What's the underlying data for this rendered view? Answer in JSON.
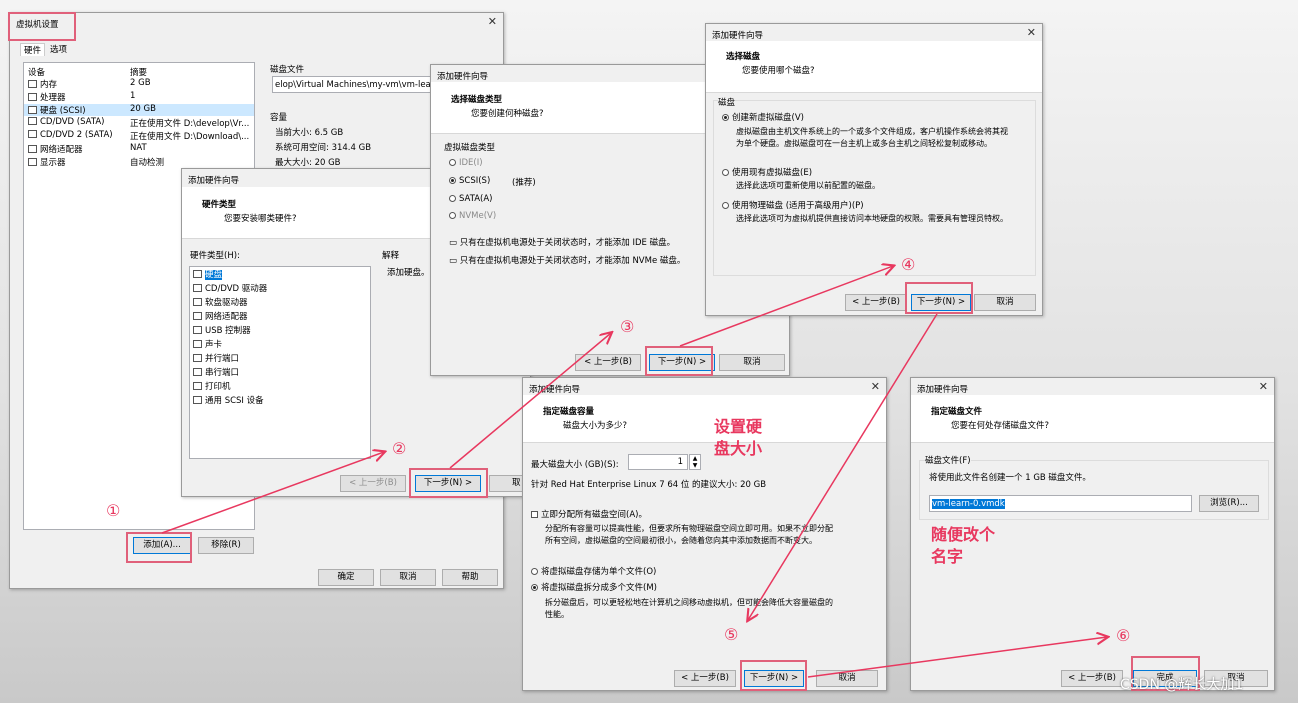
{
  "vmsettings": {
    "title": "虚拟机设置",
    "tab_hardware": "硬件",
    "tab_options": "选项",
    "col_device": "设备",
    "col_summary": "摘要",
    "devices": [
      {
        "icon": "memory-icon",
        "name": "内存",
        "summary": "2 GB"
      },
      {
        "icon": "cpu-icon",
        "name": "处理器",
        "summary": "1"
      },
      {
        "icon": "harddisk-icon",
        "name": "硬盘 (SCSI)",
        "summary": "20 GB"
      },
      {
        "icon": "cd-icon",
        "name": "CD/DVD (SATA)",
        "summary": "正在使用文件 D:\\develop\\Vr..."
      },
      {
        "icon": "cd-icon",
        "name": "CD/DVD 2 (SATA)",
        "summary": "正在使用文件 D:\\Download\\..."
      },
      {
        "icon": "network-icon",
        "name": "网络适配器",
        "summary": "NAT"
      },
      {
        "icon": "display-icon",
        "name": "显示器",
        "summary": "自动检测"
      }
    ],
    "diskfile_label": "磁盘文件",
    "diskfile_value": "elop\\Virtual Machines\\my-vm\\vm-learn\\vr",
    "capacity_label": "容量",
    "current_size": "当前大小: 6.5 GB",
    "free_space": "系统可用空间: 314.4 GB",
    "max_size": "最大大小: 20 GB",
    "add": "添加(A)...",
    "remove": "移除(R)",
    "ok": "确定",
    "cancel": "取消",
    "help": "帮助"
  },
  "wiz1": {
    "title": "添加硬件向导",
    "heading": "硬件类型",
    "sub": "您要安装哪类硬件?",
    "list_label": "硬件类型(H):",
    "explain_label": "解释",
    "explain_text": "添加硬盘。",
    "items": [
      {
        "icon": "harddisk-icon",
        "label": "硬盘"
      },
      {
        "icon": "cd-icon",
        "label": "CD/DVD 驱动器"
      },
      {
        "icon": "floppy-icon",
        "label": "软盘驱动器"
      },
      {
        "icon": "network-icon",
        "label": "网络适配器"
      },
      {
        "icon": "usb-icon",
        "label": "USB 控制器"
      },
      {
        "icon": "sound-icon",
        "label": "声卡"
      },
      {
        "icon": "parallel-port-icon",
        "label": "并行端口"
      },
      {
        "icon": "serial-port-icon",
        "label": "串行端口"
      },
      {
        "icon": "printer-icon",
        "label": "打印机"
      },
      {
        "icon": "scsi-icon",
        "label": "通用 SCSI 设备"
      }
    ],
    "back": "< 上一步(B)",
    "next": "下一步(N) >",
    "cancel_cut": "取"
  },
  "wiz2": {
    "title": "添加硬件向导",
    "heading": "选择磁盘类型",
    "sub": "您要创建何种磁盘?",
    "group": "虚拟磁盘类型",
    "ide": "IDE(I)",
    "scsi": "SCSI(S)",
    "recommended": "(推荐)",
    "sata": "SATA(A)",
    "nvme": "NVMe(V)",
    "note_ide": "只有在虚拟机电源处于关闭状态时，才能添加 IDE 磁盘。",
    "note_nvme": "只有在虚拟机电源处于关闭状态时，才能添加 NVMe 磁盘。",
    "back": "< 上一步(B)",
    "next": "下一步(N) >",
    "cancel": "取消"
  },
  "wiz3": {
    "title": "添加硬件向导",
    "heading": "选择磁盘",
    "sub": "您要使用哪个磁盘?",
    "group": "磁盘",
    "opt_new": "创建新虚拟磁盘(V)",
    "opt_new_desc1": "虚拟磁盘由主机文件系统上的一个或多个文件组成，客户机操作系统会将其视",
    "opt_new_desc2": "为单个硬盘。虚拟磁盘可在一台主机上或多台主机之间轻松复制或移动。",
    "opt_existing": "使用现有虚拟磁盘(E)",
    "opt_existing_desc": "选择此选项可重新使用以前配置的磁盘。",
    "opt_physical": "使用物理磁盘 (适用于高级用户)(P)",
    "opt_physical_desc": "选择此选项可为虚拟机提供直接访问本地硬盘的权限。需要具有管理员特权。",
    "back": "< 上一步(B)",
    "next": "下一步(N) >",
    "cancel": "取消"
  },
  "wiz4": {
    "title": "添加硬件向导",
    "heading": "指定磁盘容量",
    "sub": "磁盘大小为多少?",
    "size_label": "最大磁盘大小 (GB)(S):",
    "size_value": "1",
    "recommend": "针对 Red Hat Enterprise Linux 7 64 位 的建议大小: 20 GB",
    "allocate": "立即分配所有磁盘空间(A)。",
    "allocate_desc1": "分配所有容量可以提高性能，但要求所有物理磁盘空间立即可用。如果不立即分配",
    "allocate_desc2": "所有空间，虚拟磁盘的空间最初很小，会随着您向其中添加数据而不断变大。",
    "single": "将虚拟磁盘存储为单个文件(O)",
    "multi": "将虚拟磁盘拆分成多个文件(M)",
    "split_desc1": "拆分磁盘后，可以更轻松地在计算机之间移动虚拟机，但可能会降低大容量磁盘的",
    "split_desc2": "性能。",
    "back": "< 上一步(B)",
    "next": "下一步(N) >",
    "cancel": "取消"
  },
  "wiz5": {
    "title": "添加硬件向导",
    "heading": "指定磁盘文件",
    "sub": "您要在何处存储磁盘文件?",
    "group": "磁盘文件(F)",
    "desc": "将使用此文件名创建一个 1 GB 磁盘文件。",
    "file_value": "vm-learn-0.vmdk",
    "browse": "浏览(R)...",
    "back": "< 上一步(B)",
    "finish": "完成",
    "cancel": "取消"
  },
  "annotations": {
    "steps": [
      "①",
      "②",
      "③",
      "④",
      "⑤",
      "⑥"
    ],
    "set_size_l1": "设置硬",
    "set_size_l2": "盘大小",
    "rename_l1": "随便改个",
    "rename_l2": "名字",
    "watermark": "CSDN @辉长大加1",
    "accent": "#e8385f"
  }
}
